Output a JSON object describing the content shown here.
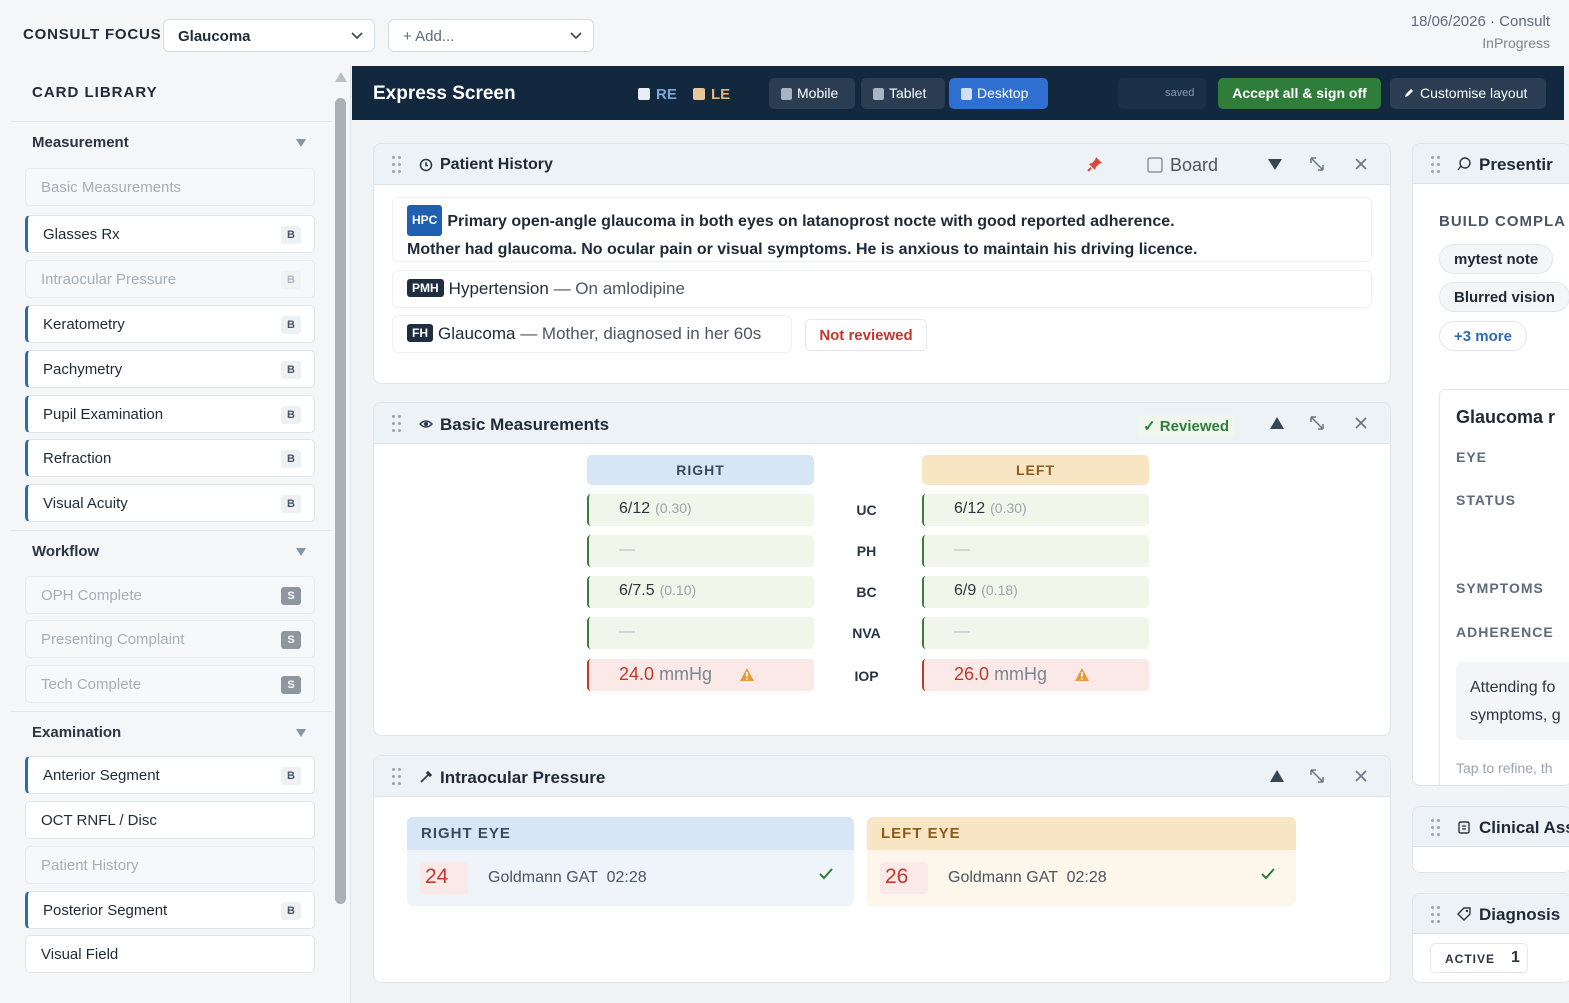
{
  "topbar": {
    "focus_label": "CONSULT FOCUS",
    "focus_value": "Glaucoma",
    "add_placeholder": "+ Add...",
    "date": "18/06/2026 · Consult",
    "status": "InProgress"
  },
  "sidebar": {
    "title": "CARD LIBRARY",
    "groups": [
      {
        "name": "Measurement",
        "items": [
          {
            "label": "Basic Measurements",
            "badge": ""
          },
          {
            "label": "Glasses Rx",
            "badge": "B"
          },
          {
            "label": "Intraocular Pressure",
            "badge": "B"
          },
          {
            "label": "Keratometry",
            "badge": "B"
          },
          {
            "label": "Pachymetry",
            "badge": "B"
          },
          {
            "label": "Pupil Examination",
            "badge": "B"
          },
          {
            "label": "Refraction",
            "badge": "B"
          },
          {
            "label": "Visual Acuity",
            "badge": "B"
          }
        ]
      },
      {
        "name": "Workflow",
        "items": [
          {
            "label": "OPH Complete",
            "badge": "S"
          },
          {
            "label": "Presenting Complaint",
            "badge": "S"
          },
          {
            "label": "Tech Complete",
            "badge": "S"
          }
        ]
      },
      {
        "name": "Examination",
        "items": [
          {
            "label": "Anterior Segment",
            "badge": "B"
          },
          {
            "label": "OCT RNFL / Disc",
            "badge": ""
          },
          {
            "label": "Patient History",
            "badge": ""
          },
          {
            "label": "Posterior Segment",
            "badge": "B"
          },
          {
            "label": "Visual Field",
            "badge": ""
          }
        ]
      }
    ]
  },
  "express": {
    "title": "Express Screen",
    "eye_re": "RE",
    "eye_le": "LE",
    "devices": [
      "Mobile",
      "Tablet",
      "Desktop"
    ],
    "saved": "saved",
    "accept": "Accept all & sign off",
    "customise": "Customise layout"
  },
  "patient_history": {
    "title": "Patient History",
    "board_label": "Board",
    "hpc_tag": "HPC",
    "hpc_line1": "Primary open-angle glaucoma in both eyes on latanoprost nocte with good reported adherence.",
    "hpc_line2": "Mother had glaucoma. No ocular pain or visual symptoms. He is anxious to maintain his driving licence.",
    "pmh_tag": "PMH",
    "pmh_main": "Hypertension",
    "pmh_sub": " — On amlodipine",
    "fh_tag": "FH",
    "fh_main": "Glaucoma",
    "fh_sub": " — Mother, diagnosed in her 60s",
    "not_reviewed": "Not reviewed"
  },
  "basic": {
    "title": "Basic Measurements",
    "reviewed": "✓ Reviewed",
    "right_head": "RIGHT",
    "left_head": "LEFT",
    "rows": [
      {
        "label": "UC",
        "right": "6/12",
        "right_sec": "(0.30)",
        "left": "6/12",
        "left_sec": "(0.30)"
      },
      {
        "label": "PH",
        "right": "—",
        "right_sec": "",
        "left": "—",
        "left_sec": ""
      },
      {
        "label": "BC",
        "right": "6/7.5",
        "right_sec": "(0.10)",
        "left": "6/9",
        "left_sec": "(0.18)"
      },
      {
        "label": "NVA",
        "right": "—",
        "right_sec": "",
        "left": "—",
        "left_sec": ""
      }
    ],
    "iop_label": "IOP",
    "iop_right": "24.0",
    "iop_left": "26.0",
    "iop_unit": "mmHg"
  },
  "iop": {
    "title": "Intraocular Pressure",
    "right_head": "RIGHT EYE",
    "left_head": "LEFT EYE",
    "right_value": "24",
    "left_value": "26",
    "right_method": "Goldmann GAT  02:28",
    "left_method": "Goldmann GAT  02:28"
  },
  "presenting": {
    "title": "Presentir",
    "build_label": "BUILD COMPLA",
    "chips": [
      "mytest note",
      "Blurred vision",
      "+3 more"
    ],
    "glaucoma_title": "Glaucoma r",
    "labels": [
      "EYE",
      "STATUS",
      "SYMPTOMS",
      "ADHERENCE"
    ],
    "note_line1": "Attending fo",
    "note_line2": "symptoms, g",
    "hint": "Tap to refine, th"
  },
  "clinical": {
    "title": "Clinical Ass"
  },
  "diagnosis": {
    "title": "Diagnosis",
    "active_label": "ACTIVE",
    "active_count": "1"
  },
  "colors": {
    "navy": "#12283f",
    "accent_blue": "#2f6fd0",
    "accept_green": "#2f7d3a",
    "alert_red": "#c0392b"
  }
}
